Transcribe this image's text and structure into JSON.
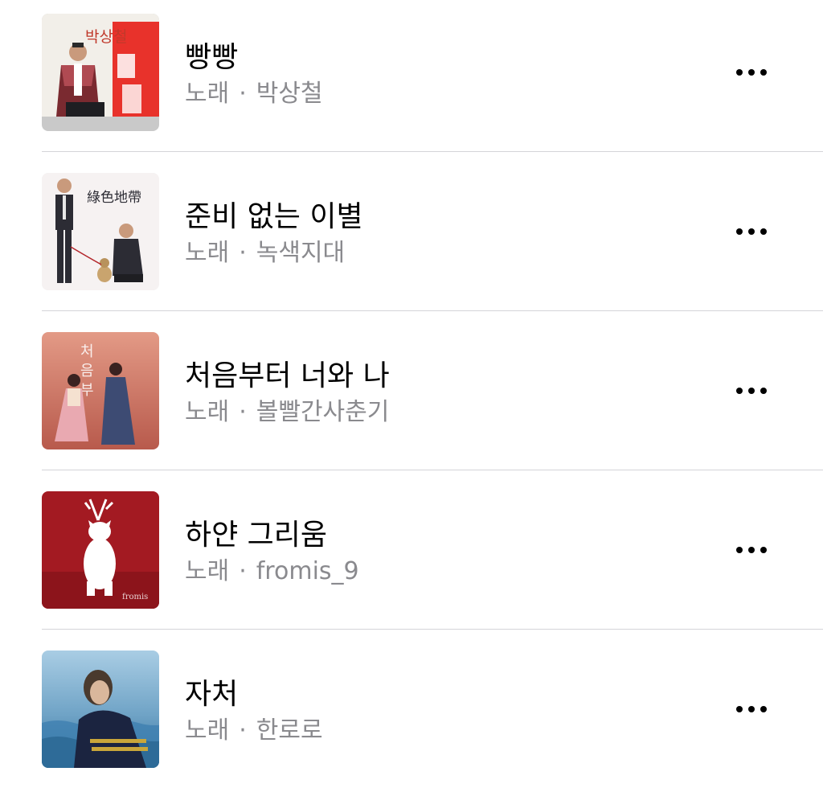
{
  "songs": [
    {
      "title": "빵빵",
      "type": "노래",
      "separator": "·",
      "artist": "박상철",
      "art": {
        "colors": [
          "#c9c9c9",
          "#e8322b",
          "#f2efe9"
        ],
        "cover_text": "박상철"
      }
    },
    {
      "title": "준비 없는 이별",
      "type": "노래",
      "separator": "·",
      "artist": "녹색지대",
      "art": {
        "colors": [
          "#f6f2f2",
          "#2c2c34",
          "#3a7a3a"
        ],
        "cover_text": "綠色地帶"
      }
    },
    {
      "title": "처음부터 너와 나",
      "type": "노래",
      "separator": "·",
      "artist": "볼빨간사춘기",
      "art": {
        "colors": [
          "#d98473",
          "#7d2f2a",
          "#3d4b73"
        ]
      }
    },
    {
      "title": "하얀 그리움",
      "type": "노래",
      "separator": "·",
      "artist": "fromis_9",
      "art": {
        "colors": [
          "#a31a22",
          "#ffffff",
          "#c62a33"
        ]
      }
    },
    {
      "title": "자처",
      "type": "노래",
      "separator": "·",
      "artist": "한로로",
      "art": {
        "colors": [
          "#7fb0cf",
          "#1f4e78",
          "#1b2440"
        ]
      }
    }
  ]
}
